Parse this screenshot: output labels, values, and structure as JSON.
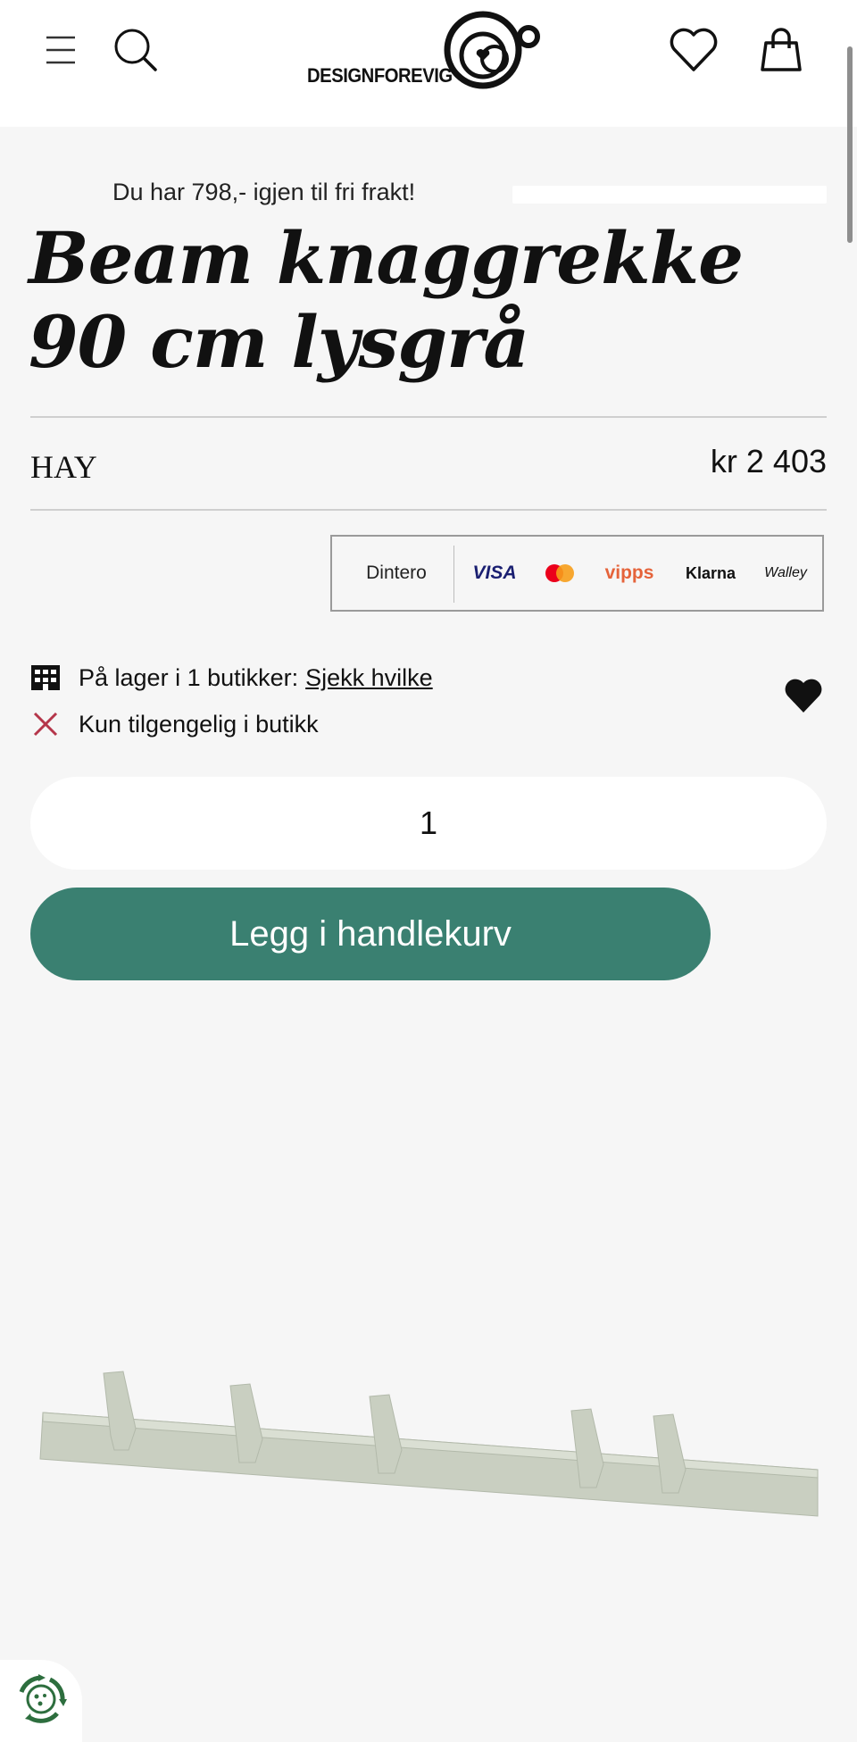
{
  "header": {
    "logo_text": "DESIGNFOREVIG",
    "icons": [
      "menu-icon",
      "search-icon",
      "heart-icon",
      "shopping-bag-icon"
    ]
  },
  "shipping": {
    "message": "Du har 798,- igjen til fri frakt!",
    "progress": 0.0
  },
  "product": {
    "title": "Beam knaggrekke 90 cm lysgrå",
    "brand": "HAY",
    "price": "kr 2 403"
  },
  "payment": {
    "dintero": "Dintero",
    "visa": "VISA",
    "mastercard": "mastercard-logo",
    "vipps": "vipps",
    "klarna": "Klarna",
    "walley": "Walley"
  },
  "stock": {
    "in_stock_text": "På lager i 1 butikker:",
    "check_link": "Sjekk hvilke",
    "store_only_text": "Kun tilgengelig i butikk"
  },
  "cart": {
    "quantity": "1",
    "button_label": "Legg i handlekurv"
  },
  "colors": {
    "accent": "#3a8071",
    "x_mark": "#b5364a",
    "background": "#f6f6f6"
  }
}
